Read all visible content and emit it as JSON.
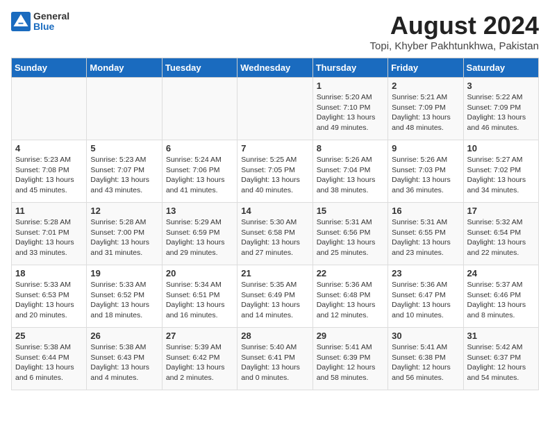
{
  "header": {
    "logo_general": "General",
    "logo_blue": "Blue",
    "main_title": "August 2024",
    "subtitle": "Topi, Khyber Pakhtunkhwa, Pakistan"
  },
  "days_of_week": [
    "Sunday",
    "Monday",
    "Tuesday",
    "Wednesday",
    "Thursday",
    "Friday",
    "Saturday"
  ],
  "weeks": [
    [
      {
        "date": "",
        "info": ""
      },
      {
        "date": "",
        "info": ""
      },
      {
        "date": "",
        "info": ""
      },
      {
        "date": "",
        "info": ""
      },
      {
        "date": "1",
        "info": "Sunrise: 5:20 AM\nSunset: 7:10 PM\nDaylight: 13 hours\nand 49 minutes."
      },
      {
        "date": "2",
        "info": "Sunrise: 5:21 AM\nSunset: 7:09 PM\nDaylight: 13 hours\nand 48 minutes."
      },
      {
        "date": "3",
        "info": "Sunrise: 5:22 AM\nSunset: 7:09 PM\nDaylight: 13 hours\nand 46 minutes."
      }
    ],
    [
      {
        "date": "4",
        "info": "Sunrise: 5:23 AM\nSunset: 7:08 PM\nDaylight: 13 hours\nand 45 minutes."
      },
      {
        "date": "5",
        "info": "Sunrise: 5:23 AM\nSunset: 7:07 PM\nDaylight: 13 hours\nand 43 minutes."
      },
      {
        "date": "6",
        "info": "Sunrise: 5:24 AM\nSunset: 7:06 PM\nDaylight: 13 hours\nand 41 minutes."
      },
      {
        "date": "7",
        "info": "Sunrise: 5:25 AM\nSunset: 7:05 PM\nDaylight: 13 hours\nand 40 minutes."
      },
      {
        "date": "8",
        "info": "Sunrise: 5:26 AM\nSunset: 7:04 PM\nDaylight: 13 hours\nand 38 minutes."
      },
      {
        "date": "9",
        "info": "Sunrise: 5:26 AM\nSunset: 7:03 PM\nDaylight: 13 hours\nand 36 minutes."
      },
      {
        "date": "10",
        "info": "Sunrise: 5:27 AM\nSunset: 7:02 PM\nDaylight: 13 hours\nand 34 minutes."
      }
    ],
    [
      {
        "date": "11",
        "info": "Sunrise: 5:28 AM\nSunset: 7:01 PM\nDaylight: 13 hours\nand 33 minutes."
      },
      {
        "date": "12",
        "info": "Sunrise: 5:28 AM\nSunset: 7:00 PM\nDaylight: 13 hours\nand 31 minutes."
      },
      {
        "date": "13",
        "info": "Sunrise: 5:29 AM\nSunset: 6:59 PM\nDaylight: 13 hours\nand 29 minutes."
      },
      {
        "date": "14",
        "info": "Sunrise: 5:30 AM\nSunset: 6:58 PM\nDaylight: 13 hours\nand 27 minutes."
      },
      {
        "date": "15",
        "info": "Sunrise: 5:31 AM\nSunset: 6:56 PM\nDaylight: 13 hours\nand 25 minutes."
      },
      {
        "date": "16",
        "info": "Sunrise: 5:31 AM\nSunset: 6:55 PM\nDaylight: 13 hours\nand 23 minutes."
      },
      {
        "date": "17",
        "info": "Sunrise: 5:32 AM\nSunset: 6:54 PM\nDaylight: 13 hours\nand 22 minutes."
      }
    ],
    [
      {
        "date": "18",
        "info": "Sunrise: 5:33 AM\nSunset: 6:53 PM\nDaylight: 13 hours\nand 20 minutes."
      },
      {
        "date": "19",
        "info": "Sunrise: 5:33 AM\nSunset: 6:52 PM\nDaylight: 13 hours\nand 18 minutes."
      },
      {
        "date": "20",
        "info": "Sunrise: 5:34 AM\nSunset: 6:51 PM\nDaylight: 13 hours\nand 16 minutes."
      },
      {
        "date": "21",
        "info": "Sunrise: 5:35 AM\nSunset: 6:49 PM\nDaylight: 13 hours\nand 14 minutes."
      },
      {
        "date": "22",
        "info": "Sunrise: 5:36 AM\nSunset: 6:48 PM\nDaylight: 13 hours\nand 12 minutes."
      },
      {
        "date": "23",
        "info": "Sunrise: 5:36 AM\nSunset: 6:47 PM\nDaylight: 13 hours\nand 10 minutes."
      },
      {
        "date": "24",
        "info": "Sunrise: 5:37 AM\nSunset: 6:46 PM\nDaylight: 13 hours\nand 8 minutes."
      }
    ],
    [
      {
        "date": "25",
        "info": "Sunrise: 5:38 AM\nSunset: 6:44 PM\nDaylight: 13 hours\nand 6 minutes."
      },
      {
        "date": "26",
        "info": "Sunrise: 5:38 AM\nSunset: 6:43 PM\nDaylight: 13 hours\nand 4 minutes."
      },
      {
        "date": "27",
        "info": "Sunrise: 5:39 AM\nSunset: 6:42 PM\nDaylight: 13 hours\nand 2 minutes."
      },
      {
        "date": "28",
        "info": "Sunrise: 5:40 AM\nSunset: 6:41 PM\nDaylight: 13 hours\nand 0 minutes."
      },
      {
        "date": "29",
        "info": "Sunrise: 5:41 AM\nSunset: 6:39 PM\nDaylight: 12 hours\nand 58 minutes."
      },
      {
        "date": "30",
        "info": "Sunrise: 5:41 AM\nSunset: 6:38 PM\nDaylight: 12 hours\nand 56 minutes."
      },
      {
        "date": "31",
        "info": "Sunrise: 5:42 AM\nSunset: 6:37 PM\nDaylight: 12 hours\nand 54 minutes."
      }
    ]
  ]
}
